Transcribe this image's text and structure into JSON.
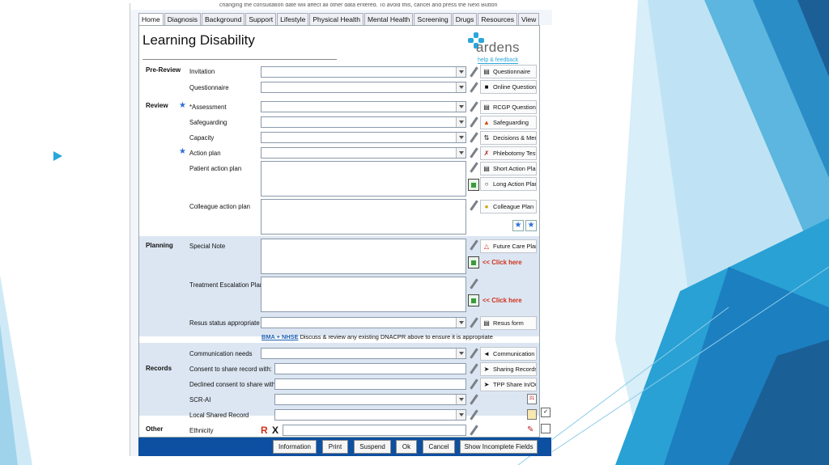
{
  "window": {
    "top_text": "changing the consultation date will affect all other data entered. To avoid this, cancel and press the Next Button"
  },
  "tabs": [
    "Home",
    "Diagnosis",
    "Background",
    "Support",
    "Lifestyle",
    "Physical Health",
    "Mental Health",
    "Screening",
    "Drugs",
    "Resources",
    "View"
  ],
  "page_title": "Learning Disability",
  "logo": {
    "word": "ardens",
    "help": "help & feedback"
  },
  "sections": {
    "prereview": "Pre-Review",
    "review": "Review",
    "planning": "Planning",
    "records": "Records",
    "other": "Other"
  },
  "fields": {
    "invitation": "Invitation",
    "questionnaire": "Questionnaire",
    "assessment": "*Assessment",
    "safeguarding": "Safeguarding",
    "capacity": "Capacity",
    "action_plan": "Action plan",
    "patient_action_plan": "Patient action plan",
    "colleague_action_plan": "Colleague action plan",
    "special_note": "Special Note",
    "escalation": "Treatment Escalation Plan",
    "resus": "Resus status appropriate",
    "communication": "Communication needs",
    "consent_share": "Consent to share record with:",
    "declined_share": "Declined consent to share with:",
    "scr_ai": "SCR-AI",
    "local_shared": "Local Shared Record",
    "ethnicity": "Ethnicity"
  },
  "right_buttons": {
    "questionnaire": "Questionnaire",
    "online_questionnaire": "Online Questionna",
    "rcgp": "RCGP Questionna",
    "safeguarding": "Safeguarding",
    "decisions": "Decisions & Ment",
    "phlebotomy": "Phlebotomy Test",
    "short_plan": "Short Action Plan",
    "long_plan": "Long Action Plan",
    "colleague_plan": "Colleague Plan",
    "future_care": "Future Care Plan",
    "resus_form": "Resus form",
    "communication": "Communication N",
    "sharing": "Sharing Records",
    "tpp": "TPP Share In/Out"
  },
  "click_here": "<< Click here",
  "resus_note": {
    "link": "BMA + NHSE",
    "text": " Discuss & review any existing DNACPR above to ensure it is appropriate"
  },
  "ethnicity_icons": {
    "r": "R",
    "x": "X"
  },
  "buttons": {
    "information": "Information",
    "print": "Print",
    "suspend": "Suspend",
    "ok": "Ok",
    "cancel": "Cancel",
    "show_incomplete": "Show Incomplete Fields"
  },
  "colors": {
    "accent": "#2aa7dc",
    "bar": "#0d4fa0",
    "band": "#dce6f2",
    "link_red": "#d0311a"
  }
}
